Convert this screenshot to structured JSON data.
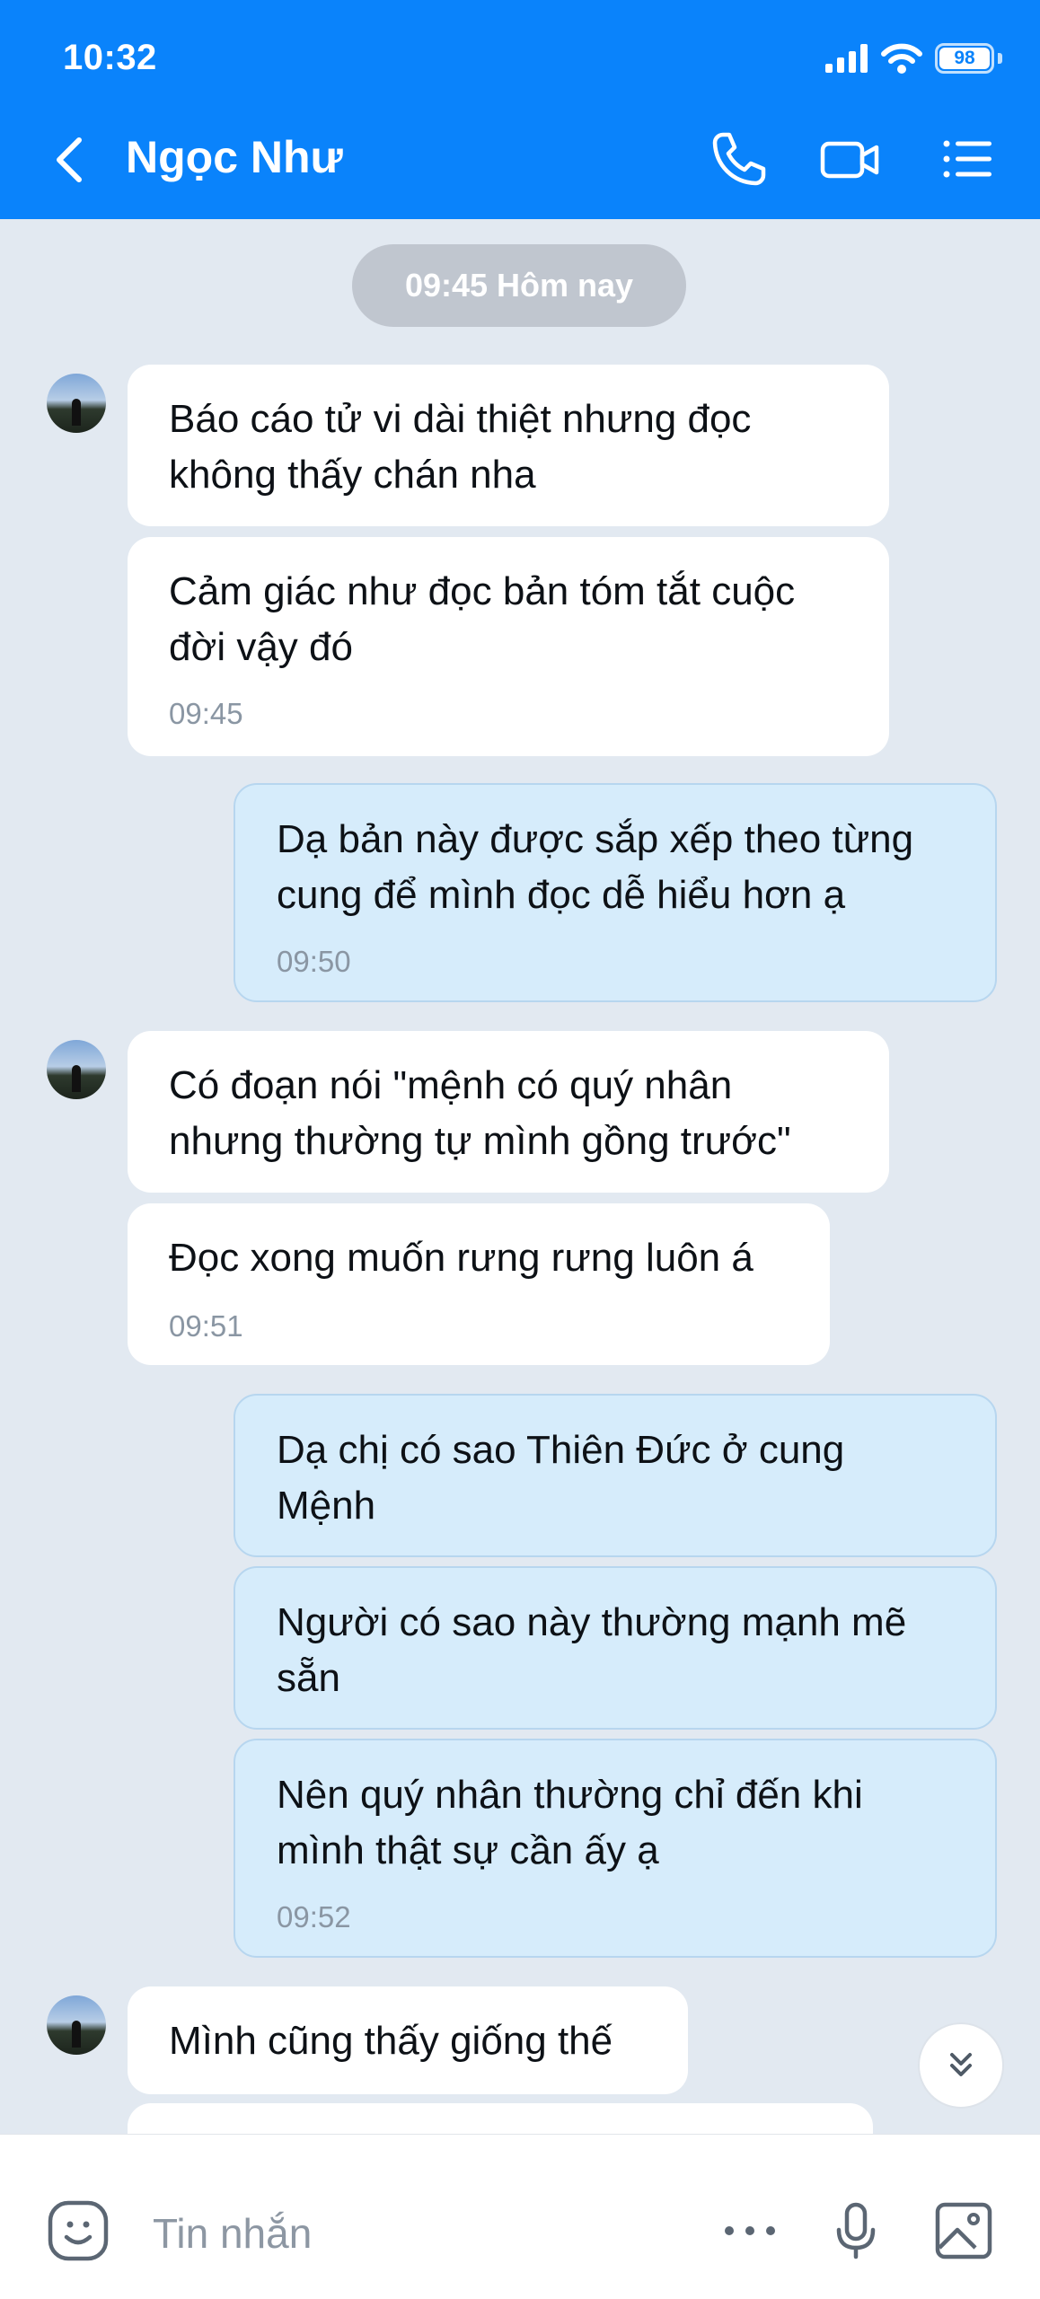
{
  "status_bar": {
    "time": "10:32",
    "battery": "98"
  },
  "header": {
    "contact_name": "Ngọc Như"
  },
  "chat": {
    "date_separator": "09:45 Hôm nay",
    "messages": [
      {
        "side": "in",
        "text": "Báo cáo tử vi dài thiệt nhưng đọc\nkhông thấy chán nha",
        "time": ""
      },
      {
        "side": "in",
        "text": "Cảm giác như đọc bản tóm tắt cuộc\nđời vậy đó",
        "time": "09:45"
      },
      {
        "side": "out",
        "text": "Dạ bản này được sắp xếp theo từng\ncung để mình đọc dễ hiểu hơn ạ",
        "time": "09:50"
      },
      {
        "side": "in",
        "text": "Có đoạn nói \"mệnh có quý nhân\nnhưng thường tự mình gồng trước\"",
        "time": ""
      },
      {
        "side": "in",
        "text": "Đọc xong muốn rưng rưng luôn á",
        "time": "09:51"
      },
      {
        "side": "out",
        "text": "Dạ chị có sao Thiên Đức ở cung\nMệnh",
        "time": ""
      },
      {
        "side": "out",
        "text": "Người có sao này thường mạnh mẽ\nsẵn",
        "time": ""
      },
      {
        "side": "out",
        "text": "Nên quý nhân thường chỉ đến khi\nmình thật sự cần ấy ạ",
        "time": "09:52"
      },
      {
        "side": "in",
        "text": "Mình cũng thấy giống thế",
        "time": ""
      }
    ]
  },
  "composer": {
    "placeholder": "Tin nhắn"
  },
  "colors": {
    "header_bg": "#0a83fb",
    "chat_bg": "#e2e9f1",
    "outgoing_bubble": "#d6ecfb",
    "incoming_bubble": "#ffffff"
  }
}
